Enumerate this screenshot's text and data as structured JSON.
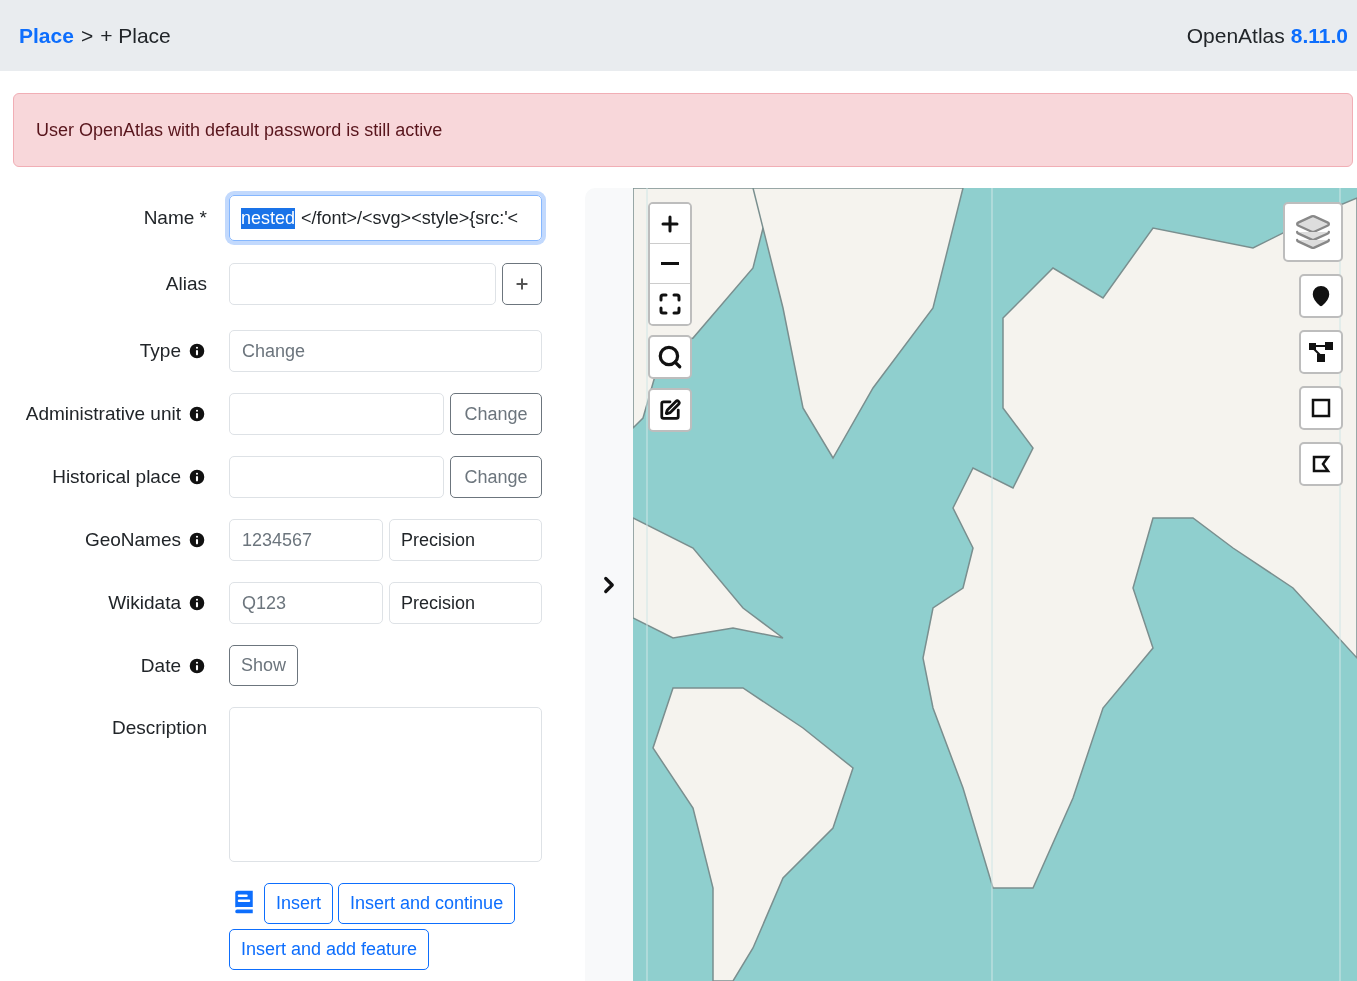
{
  "header": {
    "breadcrumb": {
      "link": "Place",
      "separator": ">",
      "current": "+ Place"
    },
    "app": {
      "name": "OpenAtlas",
      "version": "8.11.0"
    }
  },
  "alert": {
    "text": "User OpenAtlas with default password is still active"
  },
  "form": {
    "fields": [
      {
        "kind": "focused_text",
        "label": "Name *",
        "info": false,
        "value_selected": "nested",
        "value": "</font>/<svg><style>{src:'<"
      },
      {
        "kind": "text_add",
        "label": "Alias",
        "info": false
      },
      {
        "kind": "picker",
        "label": "Type",
        "info": true,
        "placeholder": "Change"
      },
      {
        "kind": "picker_button",
        "label": "Administrative unit",
        "info": true,
        "button": "Change"
      },
      {
        "kind": "picker_button",
        "label": "Historical place",
        "info": true,
        "button": "Change"
      },
      {
        "kind": "pair",
        "label": "GeoNames",
        "info": true,
        "placeholder": "1234567",
        "select": "Precision"
      },
      {
        "kind": "pair",
        "label": "Wikidata",
        "info": true,
        "placeholder": "Q123",
        "select": "Precision"
      },
      {
        "kind": "show",
        "label": "Date",
        "info": true,
        "button": "Show"
      },
      {
        "kind": "textarea",
        "label": "Description",
        "info": false
      }
    ],
    "buttons": [
      {
        "label": "Insert"
      },
      {
        "label": "Insert and continue"
      },
      {
        "label": "Insert and add feature"
      }
    ]
  },
  "map": {
    "left_controls": [
      {
        "kind": "zoom_in"
      },
      {
        "kind": "zoom_out"
      },
      {
        "kind": "fullscreen"
      },
      {
        "kind": "search"
      },
      {
        "kind": "edit"
      }
    ],
    "right_controls": [
      {
        "kind": "layers"
      },
      {
        "kind": "marker"
      },
      {
        "kind": "polyline"
      },
      {
        "kind": "rectangle"
      },
      {
        "kind": "polygon"
      }
    ]
  }
}
